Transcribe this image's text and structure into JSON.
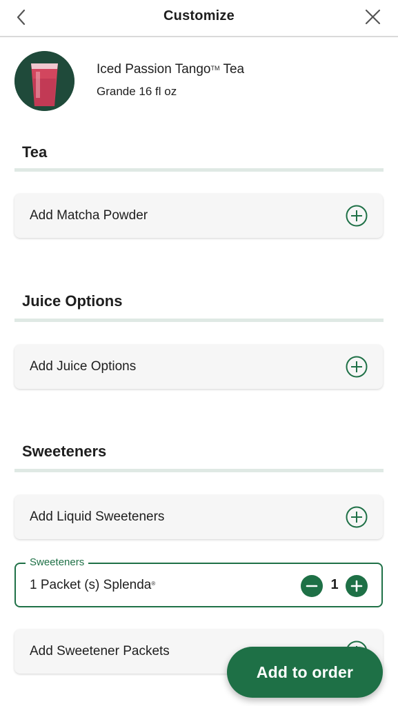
{
  "header": {
    "title": "Customize",
    "back_icon": "chevron-left-icon",
    "close_icon": "close-icon"
  },
  "product": {
    "name": "Iced Passion Tango",
    "trademark": "TM",
    "name_suffix": "Tea",
    "size": "Grande 16 fl oz"
  },
  "sections": {
    "tea": {
      "title": "Tea",
      "option_label": "Add Matcha Powder"
    },
    "juice": {
      "title": "Juice Options",
      "option_label": "Add Juice Options"
    },
    "sweeteners": {
      "title": "Sweeteners",
      "liquid_label": "Add Liquid Sweeteners",
      "selected": {
        "legend": "Sweeteners",
        "label": "1 Packet (s) Splenda",
        "registered": "®",
        "quantity": "1"
      },
      "packets_label": "Add Sweetener Packets"
    }
  },
  "cta": {
    "add_to_order": "Add to order"
  },
  "colors": {
    "brand_green": "#1e7046",
    "section_rule": "#dfe9e4",
    "card_bg": "#f6f6f6"
  }
}
